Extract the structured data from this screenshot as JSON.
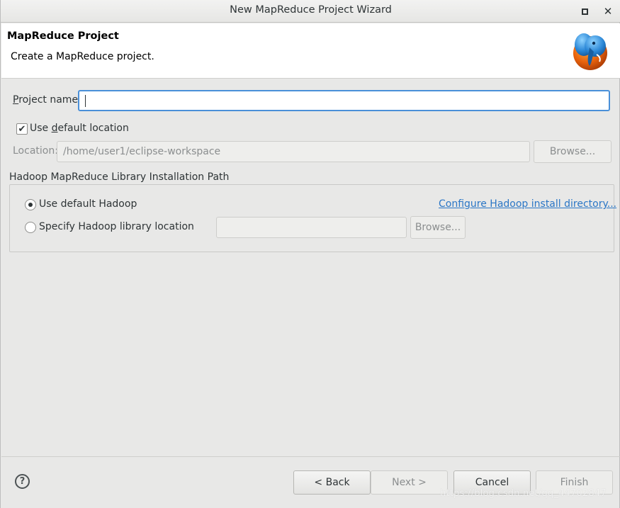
{
  "window": {
    "title": "New MapReduce Project Wizard"
  },
  "banner": {
    "heading": "MapReduce Project",
    "description": "Create a MapReduce project."
  },
  "form": {
    "project_name": {
      "label_mnemonic": "P",
      "label_rest": "roject name:",
      "value": ""
    },
    "use_default_location": {
      "label_before": "Use ",
      "label_mnemonic": "d",
      "label_after": "efault location",
      "checked": true
    },
    "location": {
      "label": "Location:",
      "value": "/home/user1/eclipse-workspace",
      "browse_label": "Browse..."
    }
  },
  "hadoop_group": {
    "title": "Hadoop MapReduce Library Installation Path",
    "use_default_label": "Use default Hadoop",
    "configure_link": "Configure Hadoop install directory...",
    "specify_label": "Specify Hadoop library location",
    "library_location_value": "",
    "browse_label": "Browse...",
    "selected": "use_default"
  },
  "footer": {
    "help_symbol": "?",
    "back_label": "< Back",
    "next_label": "Next >",
    "cancel_label": "Cancel",
    "finish_label": "Finish"
  },
  "watermark": "https://blog.csdn.net/qq_44702847",
  "colors": {
    "accent": "#4a90d9",
    "link": "#2a76c6",
    "background": "#e8e8e7"
  }
}
